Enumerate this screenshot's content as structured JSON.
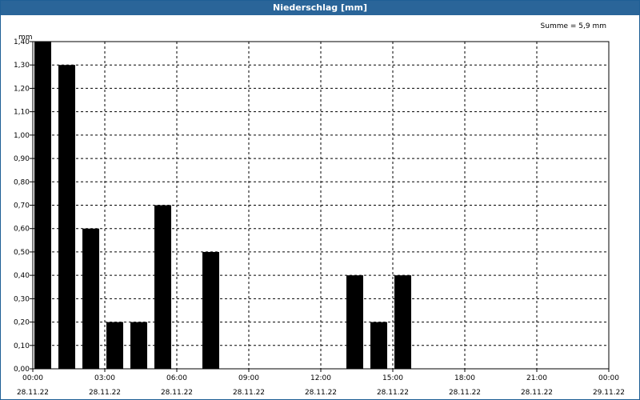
{
  "window": {
    "title": "Niederschlag [mm]"
  },
  "chart_data": {
    "type": "bar",
    "title": "Niederschlag [mm]",
    "ylabel": "mm",
    "xlabel": "",
    "summary": "Summe = 5,9 mm",
    "ylim": [
      0,
      1.4
    ],
    "xlim_hours": [
      0,
      24
    ],
    "yticks": [
      0,
      0.1,
      0.2,
      0.3,
      0.4,
      0.5,
      0.6,
      0.7,
      0.8,
      0.9,
      1.0,
      1.1,
      1.2,
      1.3,
      1.4
    ],
    "ytick_labels": [
      "0,00",
      "0,10",
      "0,20",
      "0,30",
      "0,40",
      "0,50",
      "0,60",
      "0,70",
      "0,80",
      "0,90",
      "1,00",
      "1,10",
      "1,20",
      "1,30",
      "1,40"
    ],
    "xticks": [
      {
        "time": "00:00",
        "date": "28.11.22"
      },
      {
        "time": "03:00",
        "date": "28.11.22"
      },
      {
        "time": "06:00",
        "date": "28.11.22"
      },
      {
        "time": "09:00",
        "date": "28.11.22"
      },
      {
        "time": "12:00",
        "date": "28.11.22"
      },
      {
        "time": "15:00",
        "date": "28.11.22"
      },
      {
        "time": "18:00",
        "date": "28.11.22"
      },
      {
        "time": "21:00",
        "date": "28.11.22"
      },
      {
        "time": "00:00",
        "date": "29.11.22"
      }
    ],
    "grid": true,
    "bar_color": "#000000",
    "categories": [
      "00:00",
      "01:00",
      "02:00",
      "03:00",
      "04:00",
      "05:00",
      "06:00",
      "07:00",
      "08:00",
      "09:00",
      "10:00",
      "11:00",
      "12:00",
      "13:00",
      "14:00",
      "15:00",
      "16:00",
      "17:00",
      "18:00",
      "19:00",
      "20:00",
      "21:00",
      "22:00",
      "23:00"
    ],
    "values": [
      1.4,
      1.3,
      0.6,
      0.2,
      0.2,
      0.7,
      0,
      0.5,
      0,
      0,
      0,
      0,
      0,
      0.4,
      0.2,
      0.4,
      0,
      0,
      0,
      0,
      0,
      0,
      0,
      0
    ]
  }
}
